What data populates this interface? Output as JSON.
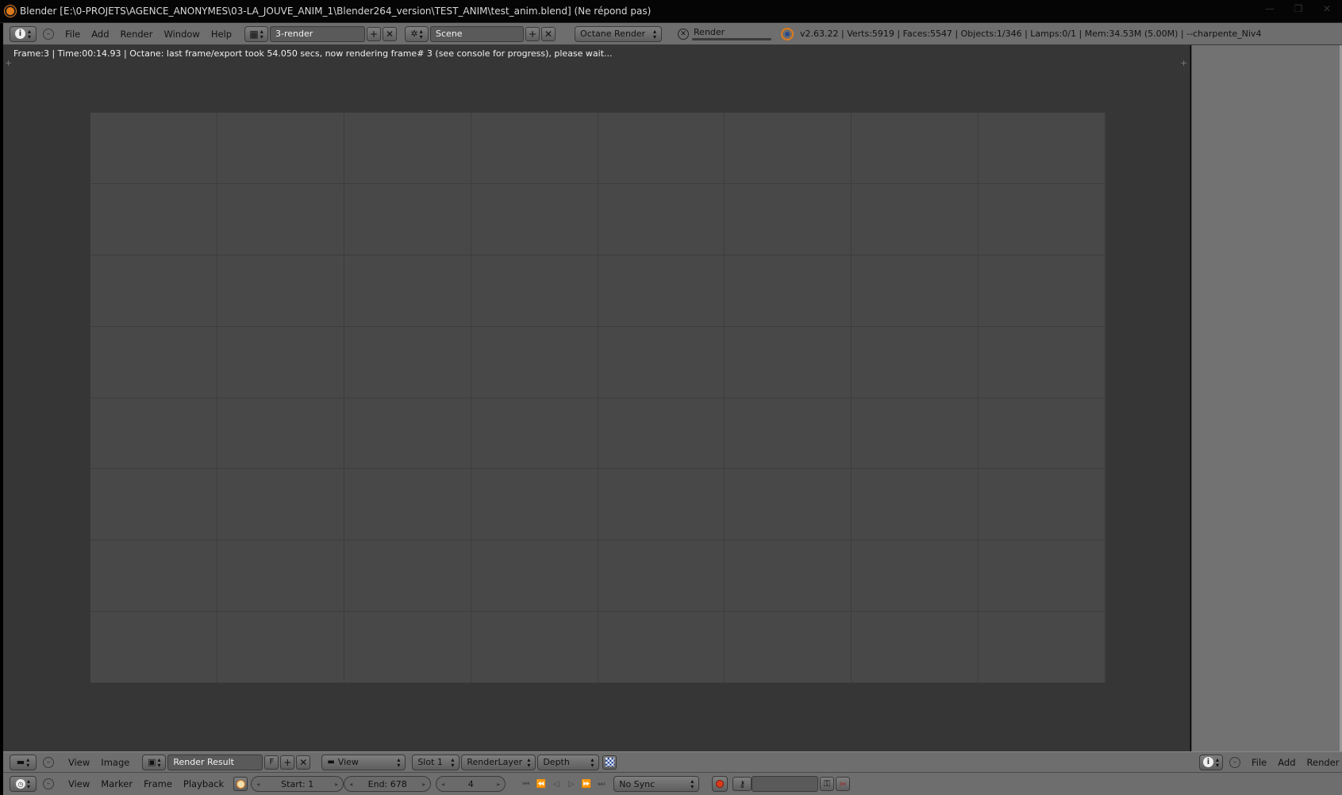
{
  "window": {
    "title": "Blender [E:\\0-PROJETS\\AGENCE_ANONYMES\\03-LA_JOUVE_ANIM_1\\Blender264_version\\TEST_ANIM\\test_anim.blend] (Ne répond pas)"
  },
  "info_header": {
    "menus": [
      "File",
      "Add",
      "Render",
      "Window",
      "Help"
    ],
    "screen_layout": "3-render",
    "scene": "Scene",
    "render_engine": "Octane Render",
    "render_progress_label": "Render",
    "stats": "v2.63.22 | Verts:5919 | Faces:5547 | Objects:1/346 | Lamps:0/1 | Mem:34.53M (5.00M) | --charpente_Niv4"
  },
  "image_editor": {
    "status_text": "Frame:3 |  Time:00:14.93 | Octane: last frame/export took 54.050 secs, now rendering frame# 3 (see console for progress), please wait...",
    "footer": {
      "menus": [
        "View",
        "Image"
      ],
      "image_name": "Render Result",
      "fake_user": "F",
      "view_mode": "View",
      "slot": "Slot 1",
      "render_layer": "RenderLayer",
      "pass": "Depth"
    }
  },
  "right_panel": {
    "menus": [
      "File",
      "Add",
      "Render"
    ]
  },
  "timeline": {
    "menus": [
      "View",
      "Marker",
      "Frame",
      "Playback"
    ],
    "start_frame": "Start: 1",
    "end_frame": "End: 678",
    "current_frame": "4",
    "sync_mode": "No Sync"
  },
  "colors": {
    "header_bg": "#6e6e6e",
    "editor_bg": "#363636",
    "canvas_bg": "#484848",
    "record_button": "#d83a1a",
    "blender_orange": "#e07a1a"
  },
  "icons": {
    "info_editor": "info-icon",
    "screen_layout": "screen-layout-icon",
    "scene": "scene-icon",
    "image_editor": "image-editor-icon",
    "timeline": "clock-icon"
  }
}
